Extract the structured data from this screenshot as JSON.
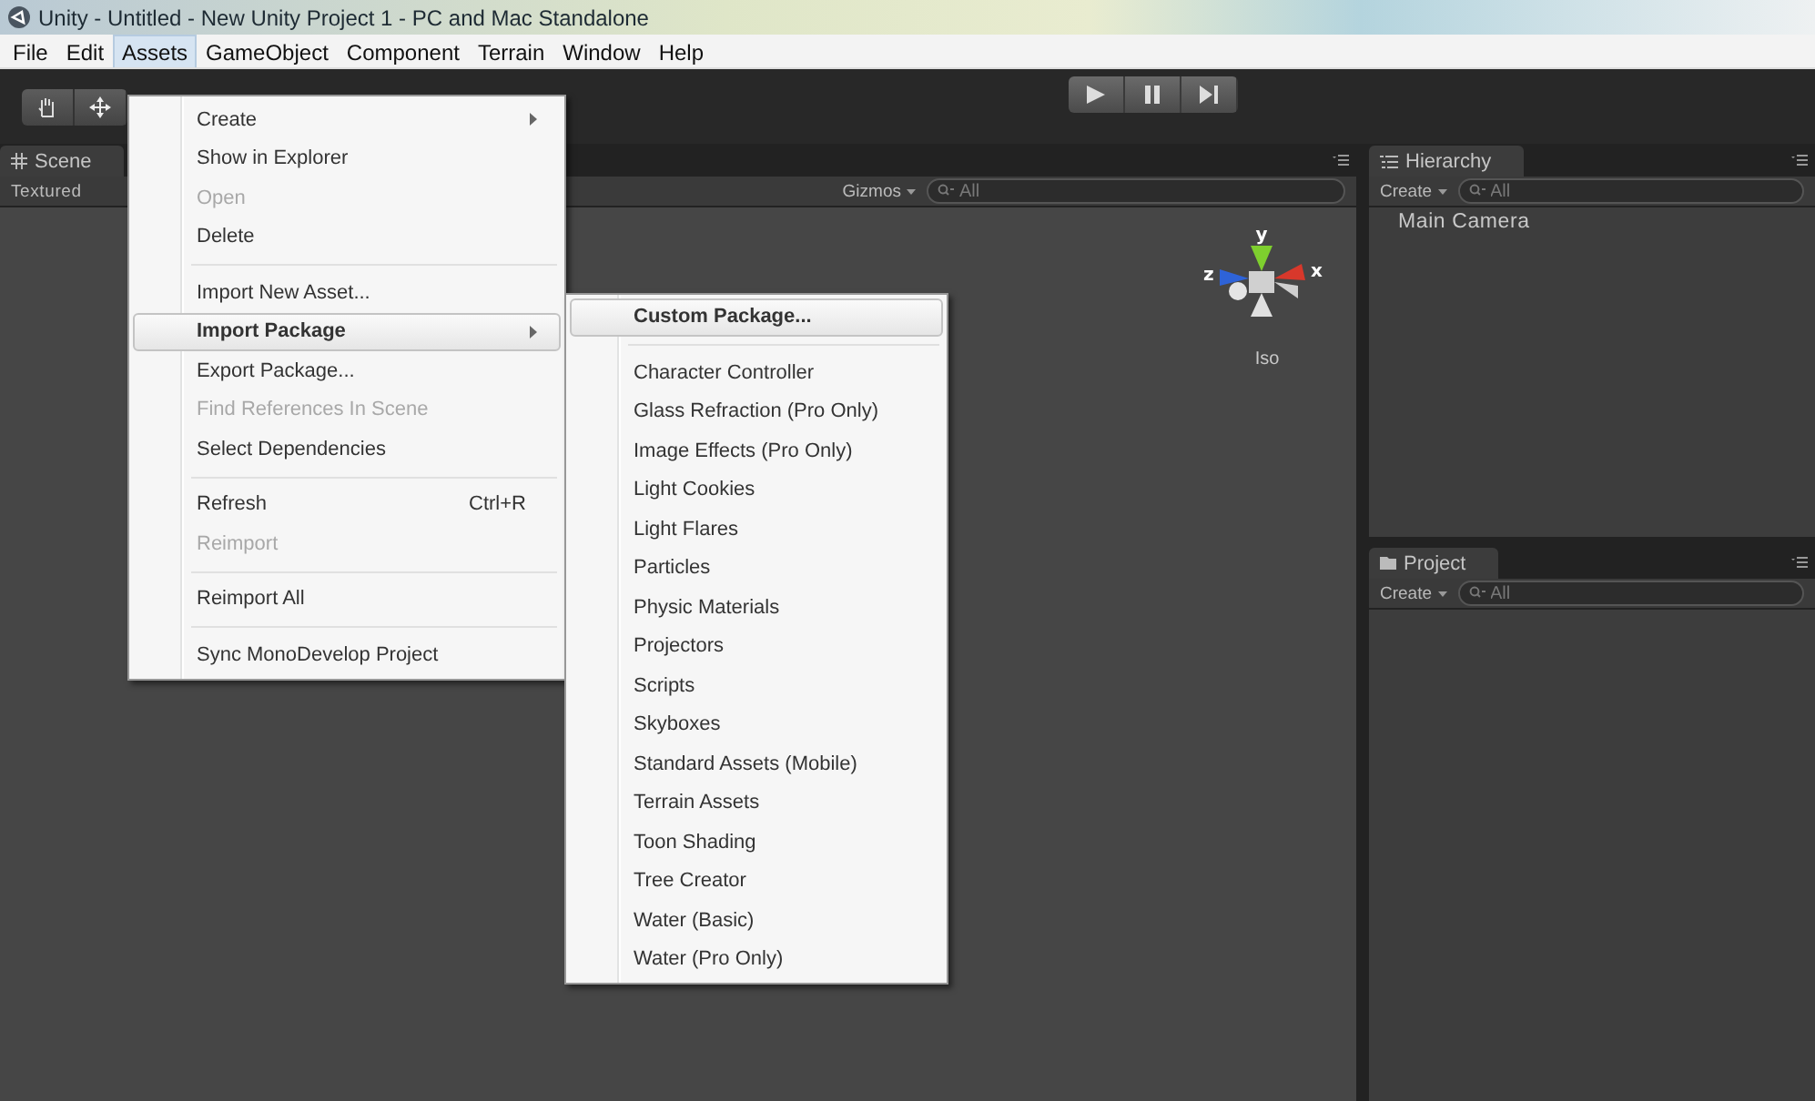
{
  "window": {
    "title": "Unity - Untitled - New Unity Project 1 - PC and Mac Standalone"
  },
  "menu_bar": [
    {
      "label": "File",
      "selected": false
    },
    {
      "label": "Edit",
      "selected": false
    },
    {
      "label": "Assets",
      "selected": true
    },
    {
      "label": "GameObject",
      "selected": false
    },
    {
      "label": "Component",
      "selected": false
    },
    {
      "label": "Terrain",
      "selected": false
    },
    {
      "label": "Window",
      "selected": false
    },
    {
      "label": "Help",
      "selected": false
    }
  ],
  "scene": {
    "tab": "Scene",
    "shading": "Textured",
    "gizmos": "Gizmos",
    "search": {
      "placeholder": "All"
    },
    "gizmo": {
      "axes": [
        "y",
        "z",
        "x"
      ],
      "projection": "Iso"
    }
  },
  "hierarchy": {
    "tab": "Hierarchy",
    "create": "Create",
    "search": {
      "placeholder": "All"
    },
    "items": [
      "Main Camera"
    ]
  },
  "project": {
    "tab": "Project",
    "create": "Create",
    "search": {
      "placeholder": "All"
    }
  },
  "assets_menu": [
    {
      "kind": "item",
      "label": "Create",
      "disabled": false,
      "submenu": true,
      "selected": false
    },
    {
      "kind": "item",
      "label": "Show in Explorer",
      "disabled": false,
      "submenu": false,
      "selected": false
    },
    {
      "kind": "item",
      "label": "Open",
      "disabled": true,
      "submenu": false,
      "selected": false
    },
    {
      "kind": "item",
      "label": "Delete",
      "disabled": false,
      "submenu": false,
      "selected": false
    },
    {
      "kind": "separator"
    },
    {
      "kind": "item",
      "label": "Import New Asset...",
      "disabled": false,
      "submenu": false,
      "selected": false
    },
    {
      "kind": "item",
      "label": "Import Package",
      "disabled": false,
      "submenu": true,
      "selected": true,
      "children": [
        {
          "kind": "item",
          "label": "Custom Package...",
          "disabled": false,
          "selected": true
        },
        {
          "kind": "separator"
        },
        {
          "kind": "item",
          "label": "Character Controller",
          "disabled": false,
          "selected": false
        },
        {
          "kind": "item",
          "label": "Glass Refraction (Pro Only)",
          "disabled": false,
          "selected": false
        },
        {
          "kind": "item",
          "label": "Image Effects (Pro Only)",
          "disabled": false,
          "selected": false
        },
        {
          "kind": "item",
          "label": "Light Cookies",
          "disabled": false,
          "selected": false
        },
        {
          "kind": "item",
          "label": "Light Flares",
          "disabled": false,
          "selected": false
        },
        {
          "kind": "item",
          "label": "Particles",
          "disabled": false,
          "selected": false
        },
        {
          "kind": "item",
          "label": "Physic Materials",
          "disabled": false,
          "selected": false
        },
        {
          "kind": "item",
          "label": "Projectors",
          "disabled": false,
          "selected": false
        },
        {
          "kind": "item",
          "label": "Scripts",
          "disabled": false,
          "selected": false
        },
        {
          "kind": "item",
          "label": "Skyboxes",
          "disabled": false,
          "selected": false
        },
        {
          "kind": "item",
          "label": "Standard Assets (Mobile)",
          "disabled": false,
          "selected": false
        },
        {
          "kind": "item",
          "label": "Terrain Assets",
          "disabled": false,
          "selected": false
        },
        {
          "kind": "item",
          "label": "Toon Shading",
          "disabled": false,
          "selected": false
        },
        {
          "kind": "item",
          "label": "Tree Creator",
          "disabled": false,
          "selected": false
        },
        {
          "kind": "item",
          "label": "Water (Basic)",
          "disabled": false,
          "selected": false
        },
        {
          "kind": "item",
          "label": "Water (Pro Only)",
          "disabled": false,
          "selected": false
        }
      ]
    },
    {
      "kind": "item",
      "label": "Export Package...",
      "disabled": false,
      "submenu": false,
      "selected": false
    },
    {
      "kind": "item",
      "label": "Find References In Scene",
      "disabled": true,
      "submenu": false,
      "selected": false
    },
    {
      "kind": "item",
      "label": "Select Dependencies",
      "disabled": false,
      "submenu": false,
      "selected": false
    },
    {
      "kind": "separator"
    },
    {
      "kind": "item",
      "label": "Refresh",
      "shortcut": "Ctrl+R",
      "disabled": false,
      "submenu": false,
      "selected": false
    },
    {
      "kind": "item",
      "label": "Reimport",
      "disabled": true,
      "submenu": false,
      "selected": false
    },
    {
      "kind": "separator"
    },
    {
      "kind": "item",
      "label": "Reimport All",
      "disabled": false,
      "submenu": false,
      "selected": false
    },
    {
      "kind": "separator"
    },
    {
      "kind": "item",
      "label": "Sync MonoDevelop Project",
      "disabled": false,
      "submenu": false,
      "selected": false
    }
  ]
}
